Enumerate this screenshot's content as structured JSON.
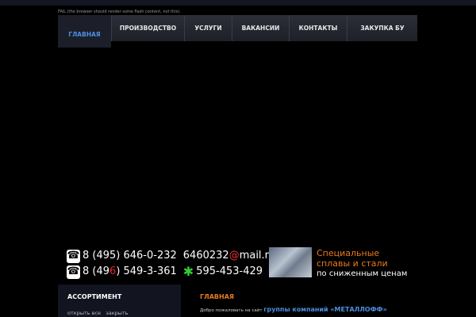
{
  "fail_text": "FAIL (the browser should render some flash content, not this).",
  "nav": [
    "ГЛАВНАЯ",
    "ПРОИЗВОДСТВО",
    "УСЛУГИ",
    "ВАКАНСИИ",
    "КОНТАКТЫ",
    "ЗАКУПКА БУ"
  ],
  "contacts": {
    "phone1": "8 (495) 646-0-232",
    "phone2_a": "8 (49",
    "phone2_red": "6",
    "phone2_b": ") 549-3-361",
    "email_user": "6460232",
    "email_at": "@",
    "email_domain": "mail.ru",
    "icq": "595-453-429"
  },
  "promo": {
    "line1": "Специальные",
    "line2": "сплавы и стали",
    "line3": "по сниженным ценам"
  },
  "sidebar": {
    "title": "АССОРТИМЕНТ",
    "open_all": "открыть все",
    "close": "закрыть"
  },
  "main": {
    "title": "ГЛАВНАЯ",
    "welcome": "Добро пожаловать на сайт",
    "company": "группы компаний «МЕТАЛЛОФФ»"
  }
}
